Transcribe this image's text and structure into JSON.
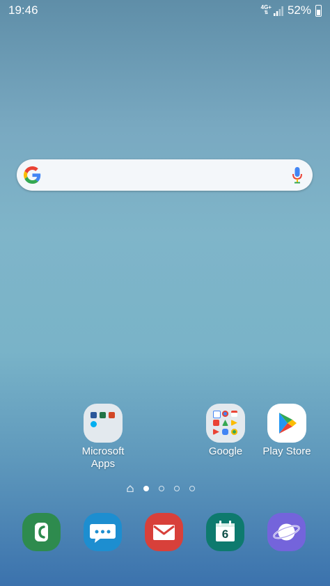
{
  "status_bar": {
    "time": "19:46",
    "network_type": "4G+",
    "battery_percent": "52%"
  },
  "search": {
    "engine_icon": "google-g-icon",
    "mic_icon": "mic-icon"
  },
  "home_apps": [
    {
      "label": "Microsoft Apps",
      "label_line1": "Microsoft",
      "label_line2": "Apps",
      "icon": "microsoft-folder-icon"
    },
    {
      "label": "Google",
      "icon": "google-folder-icon"
    },
    {
      "label": "Play Store",
      "icon": "play-store-icon"
    }
  ],
  "page_indicator": {
    "pages": 4,
    "active_index": 0,
    "home_icon": "home-icon"
  },
  "dock": [
    {
      "name": "phone",
      "icon": "phone-icon",
      "color": "#2e8b4e"
    },
    {
      "name": "messages",
      "icon": "messages-icon",
      "color": "#1d8ed0"
    },
    {
      "name": "email",
      "icon": "email-icon",
      "color": "#d8403a"
    },
    {
      "name": "calendar",
      "icon": "calendar-icon",
      "color": "#0e7a6e",
      "day": "6"
    },
    {
      "name": "internet",
      "icon": "internet-icon",
      "color": "#7464db"
    }
  ],
  "colors": {
    "google_blue": "#4285F4",
    "google_red": "#EA4335",
    "google_yellow": "#FBBC05",
    "google_green": "#34A853"
  }
}
